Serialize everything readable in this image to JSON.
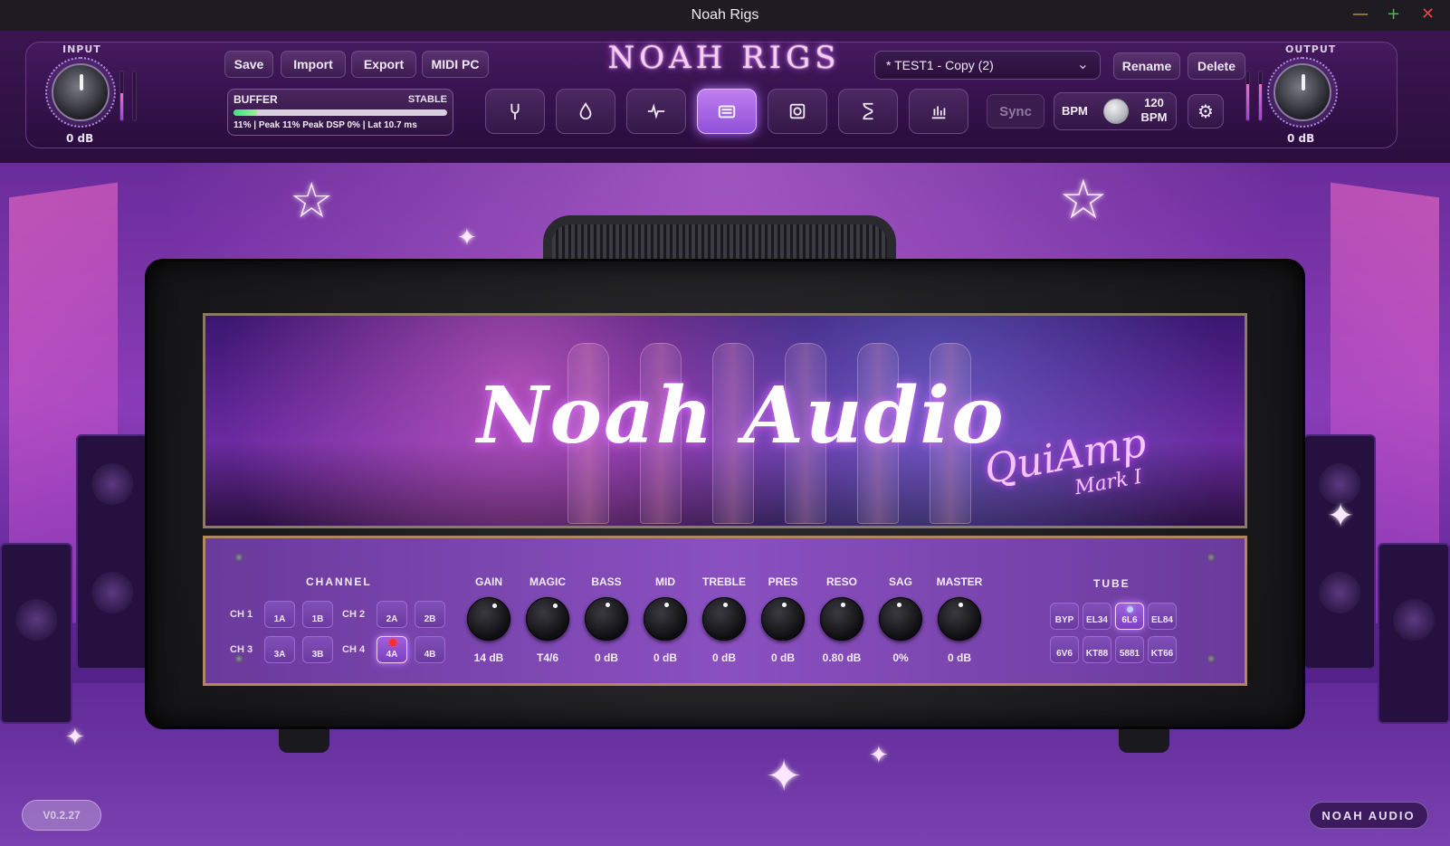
{
  "window": {
    "title": "Noah Rigs"
  },
  "input": {
    "label": "INPUT",
    "value": "0 dB",
    "meter_level": 0.55
  },
  "output": {
    "label": "OUTPUT",
    "value": "0 dB",
    "meter_level": 0.75
  },
  "toolbar": {
    "save": "Save",
    "import": "Import",
    "export": "Export",
    "midi_pc": "MIDI PC",
    "rename": "Rename",
    "delete": "Delete"
  },
  "buffer": {
    "label": "BUFFER",
    "state": "STABLE",
    "stats": "11% | Peak 11%    Peak DSP 0% | Lat 10.7 ms",
    "level": 0.11
  },
  "logo": "NOAH RIGS",
  "preset": {
    "name": "* TEST1 - Copy (2)"
  },
  "tabs": [
    {
      "name": "tuner",
      "icon": "tuning-fork-icon"
    },
    {
      "name": "drop",
      "icon": "drop-icon"
    },
    {
      "name": "pulse",
      "icon": "waveform-icon"
    },
    {
      "name": "amp",
      "icon": "amp-icon",
      "active": true
    },
    {
      "name": "cabinet",
      "icon": "speaker-icon"
    },
    {
      "name": "hourglass",
      "icon": "hourglass-icon"
    },
    {
      "name": "eq",
      "icon": "equalizer-icon"
    }
  ],
  "tempo": {
    "sync": "Sync",
    "bpm_label": "BPM",
    "bpm_value": "120",
    "bpm_unit": "BPM"
  },
  "amp": {
    "brand": "Noah Audio",
    "model": "QuiAmp",
    "mark": "Mark I",
    "channel": {
      "title": "CHANNEL",
      "rows": [
        {
          "label": "CH 1",
          "a": "1A",
          "b": "1B"
        },
        {
          "label": "CH 2",
          "a": "2A",
          "b": "2B"
        },
        {
          "label": "CH 3",
          "a": "3A",
          "b": "3B"
        },
        {
          "label": "CH 4",
          "a": "4A",
          "b": "4B"
        }
      ],
      "selected": "4A"
    },
    "controls": [
      {
        "name": "GAIN",
        "value": "14 dB",
        "rotation": 20
      },
      {
        "name": "MAGIC",
        "value": "T4/6",
        "rotation": 25
      },
      {
        "name": "BASS",
        "value": "0 dB",
        "rotation": 0
      },
      {
        "name": "MID",
        "value": "0 dB",
        "rotation": 0
      },
      {
        "name": "TREBLE",
        "value": "0 dB",
        "rotation": 0
      },
      {
        "name": "PRES",
        "value": "0 dB",
        "rotation": 0
      },
      {
        "name": "RESO",
        "value": "0.80 dB",
        "rotation": 0
      },
      {
        "name": "SAG",
        "value": "0%",
        "rotation": -10
      },
      {
        "name": "MASTER",
        "value": "0 dB",
        "rotation": 0
      }
    ],
    "tube": {
      "title": "TUBE",
      "options": [
        "BYP",
        "EL34",
        "6L6",
        "EL84",
        "6V6",
        "KT88",
        "5881",
        "KT66"
      ],
      "selected": "6L6"
    }
  },
  "footer": {
    "version": "V0.2.27",
    "brand": "NOAH AUDIO"
  }
}
